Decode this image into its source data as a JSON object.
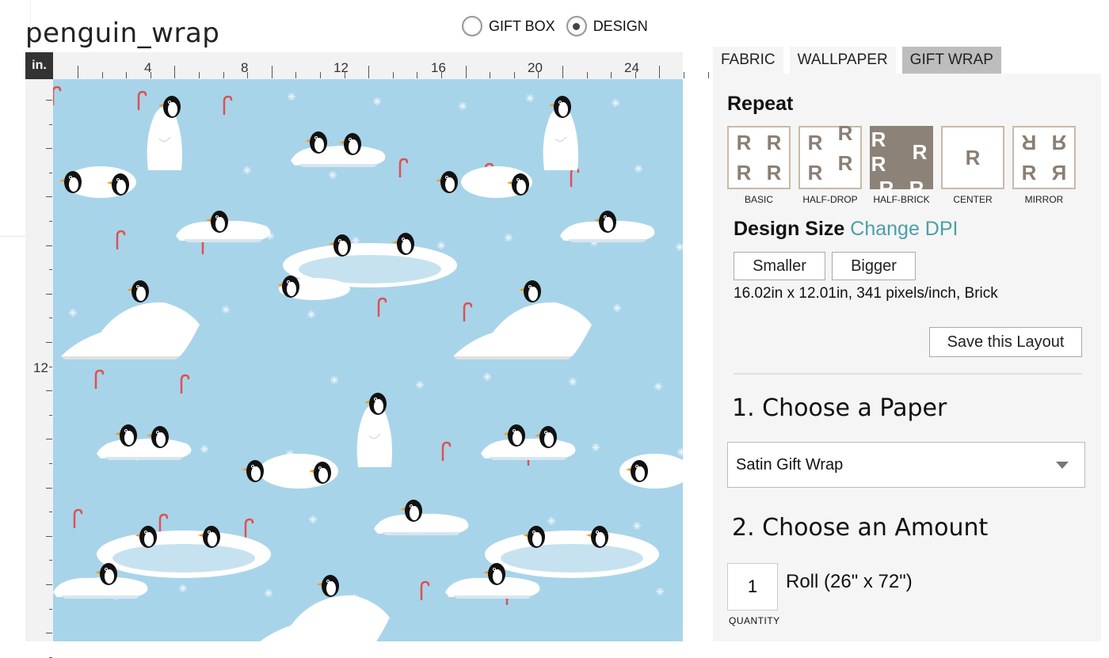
{
  "design": {
    "title": "penguin_wrap"
  },
  "view_toggle": {
    "options": [
      "GIFT BOX",
      "DESIGN"
    ],
    "selected": "DESIGN"
  },
  "ruler": {
    "unit": "in.",
    "top_labels": [
      "4",
      "8",
      "12",
      "16",
      "20",
      "24"
    ],
    "left_labels": [
      "12"
    ]
  },
  "product_tabs": [
    "FABRIC",
    "WALLPAPER",
    "GIFT WRAP"
  ],
  "active_tab": "GIFT WRAP",
  "repeat": {
    "heading": "Repeat",
    "options": [
      "BASIC",
      "HALF-DROP",
      "HALF-BRICK",
      "CENTER",
      "MIRROR"
    ],
    "selected": "HALF-BRICK"
  },
  "design_size": {
    "heading": "Design Size",
    "change_dpi": "Change DPI",
    "smaller": "Smaller",
    "bigger": "Bigger",
    "info": "16.02in x 12.01in, 341 pixels/inch, Brick",
    "save_layout": "Save this Layout"
  },
  "paper": {
    "heading": "1. Choose a Paper",
    "selected": "Satin Gift Wrap"
  },
  "amount": {
    "heading": "2. Choose an Amount",
    "quantity": "1",
    "quantity_label": "QUANTITY",
    "unit_label": "Roll (26\" x 72\")"
  },
  "colors": {
    "pattern_bg": "#a8d4ea",
    "selected_repeat": "#8c8278",
    "link": "#4aa0a8",
    "active_tab": "#bdbdbd"
  }
}
